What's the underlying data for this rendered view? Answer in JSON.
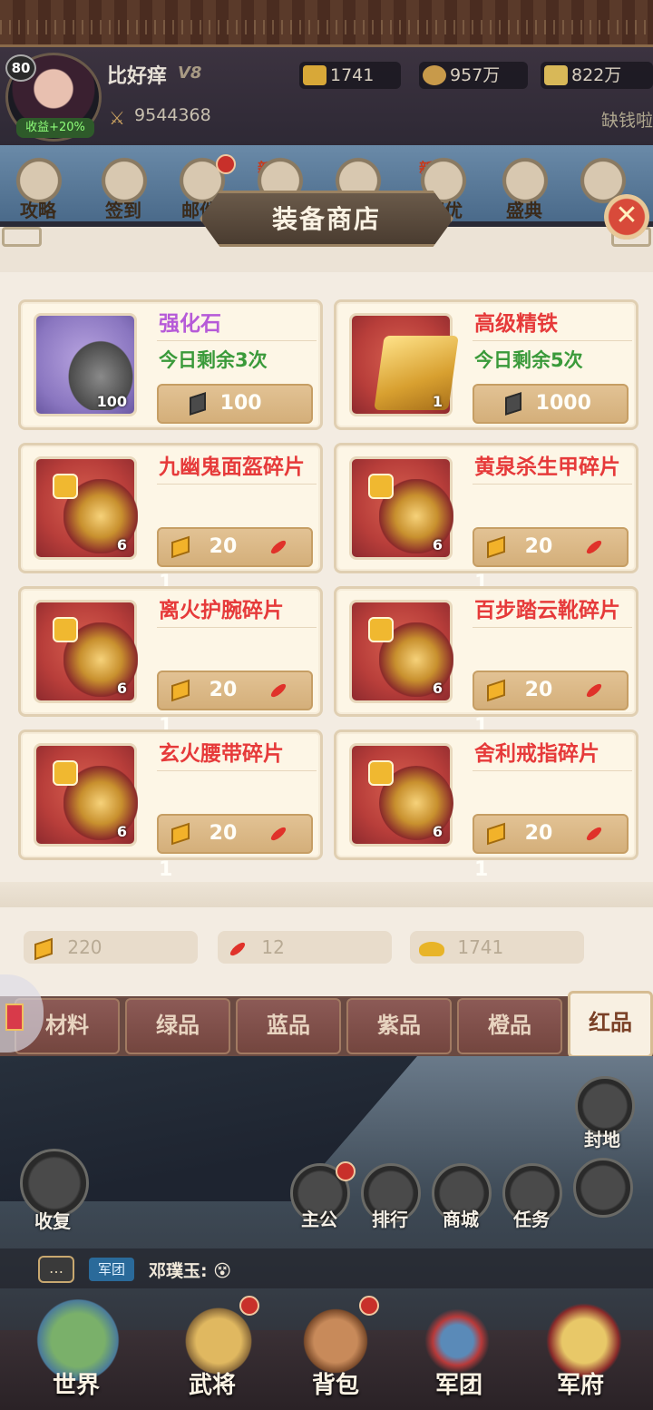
{
  "header": {
    "level": "80",
    "income_tag": "收益+20%",
    "player_name": "比好痒",
    "vip": "V8",
    "resources": [
      {
        "icon": "jade-scroll-icon",
        "value": "1741"
      },
      {
        "icon": "coin-pouch-icon",
        "value": "957万"
      },
      {
        "icon": "grain-icon",
        "value": "822万"
      }
    ],
    "power": "9544368",
    "lack_money": "缺钱啦"
  },
  "top_icons": [
    {
      "label": "攻略",
      "icon": "gate-icon"
    },
    {
      "label": "签到",
      "icon": "sign-in-icon"
    },
    {
      "label": "邮件",
      "icon": "mail-icon"
    },
    {
      "label": "",
      "icon": "bag-icon",
      "new": "新"
    },
    {
      "label": "",
      "icon": "banner-icon"
    },
    {
      "label": "赛优",
      "icon": "telescope-icon",
      "new": "新"
    },
    {
      "label": "盛典",
      "icon": "festival-icon"
    },
    {
      "label": "",
      "icon": "building-icon"
    }
  ],
  "shop": {
    "title": "装备商店",
    "close_icon": "close-icon",
    "items": [
      {
        "name": "强化石",
        "name_color": "purple",
        "remain": "今日剩余3次",
        "qty": "100",
        "price_icon": "iron-icon",
        "price": "100",
        "rarity": "purple",
        "art": "stone"
      },
      {
        "name": "高级精铁",
        "name_color": "red",
        "remain": "今日剩余5次",
        "qty": "1",
        "price_icon": "iron-icon",
        "price": "1000",
        "rarity": "red",
        "art": "gold"
      },
      {
        "name": "九幽鬼面盔碎片",
        "name_color": "red",
        "remain": "",
        "qty": "6",
        "price_gold": "20",
        "price_feather": "1",
        "rarity": "red",
        "art": "armor",
        "shard": true
      },
      {
        "name": "黄泉杀生甲碎片",
        "name_color": "red",
        "remain": "",
        "qty": "6",
        "price_gold": "20",
        "price_feather": "1",
        "rarity": "red",
        "art": "armor",
        "shard": true
      },
      {
        "name": "离火护腕碎片",
        "name_color": "red",
        "remain": "",
        "qty": "6",
        "price_gold": "20",
        "price_feather": "1",
        "rarity": "red",
        "art": "armor",
        "shard": true
      },
      {
        "name": "百步踏云靴碎片",
        "name_color": "red",
        "remain": "",
        "qty": "6",
        "price_gold": "20",
        "price_feather": "1",
        "rarity": "red",
        "art": "armor",
        "shard": true
      },
      {
        "name": "玄火腰带碎片",
        "name_color": "red",
        "remain": "",
        "qty": "6",
        "price_gold": "20",
        "price_feather": "1",
        "rarity": "red",
        "art": "armor",
        "shard": true
      },
      {
        "name": "舍利戒指碎片",
        "name_color": "red",
        "remain": "",
        "qty": "6",
        "price_gold": "20",
        "price_feather": "1",
        "rarity": "red",
        "art": "armor",
        "shard": true
      }
    ]
  },
  "wallet": [
    {
      "icon": "gold-bar-icon",
      "value": "220"
    },
    {
      "icon": "red-feather-icon",
      "value": "12"
    },
    {
      "icon": "gold-ingot-icon",
      "value": "1741"
    }
  ],
  "tabs": [
    {
      "label": "材料",
      "active": false
    },
    {
      "label": "绿品",
      "active": false
    },
    {
      "label": "蓝品",
      "active": false
    },
    {
      "label": "紫品",
      "active": false
    },
    {
      "label": "橙品",
      "active": false
    },
    {
      "label": "红品",
      "active": true
    }
  ],
  "scene": {
    "fief_label": "封地",
    "recover_label": "收复",
    "quick_buttons": [
      {
        "label": "主公",
        "badge": true
      },
      {
        "label": "排行",
        "badge": false
      },
      {
        "label": "商城",
        "badge": false
      },
      {
        "label": "任务",
        "badge": false
      }
    ],
    "move_icon": "dpad-icon",
    "chat": {
      "channel": "军团",
      "speaker": "邓璞玉:",
      "emoji": "😵"
    }
  },
  "nav": [
    {
      "label": "世界",
      "icon": "world-map-icon",
      "badge": false
    },
    {
      "label": "武将",
      "icon": "helmet-icon",
      "badge": true
    },
    {
      "label": "背包",
      "icon": "bag-icon",
      "badge": true
    },
    {
      "label": "军团",
      "icon": "legion-icon",
      "badge": false
    },
    {
      "label": "军府",
      "icon": "mansion-icon",
      "badge": false
    }
  ],
  "colors": {
    "name_red": "#e63a3a",
    "name_purple": "#b65ad8",
    "remain_green": "#3a9a3a",
    "tab_active_text": "#7a4026"
  }
}
